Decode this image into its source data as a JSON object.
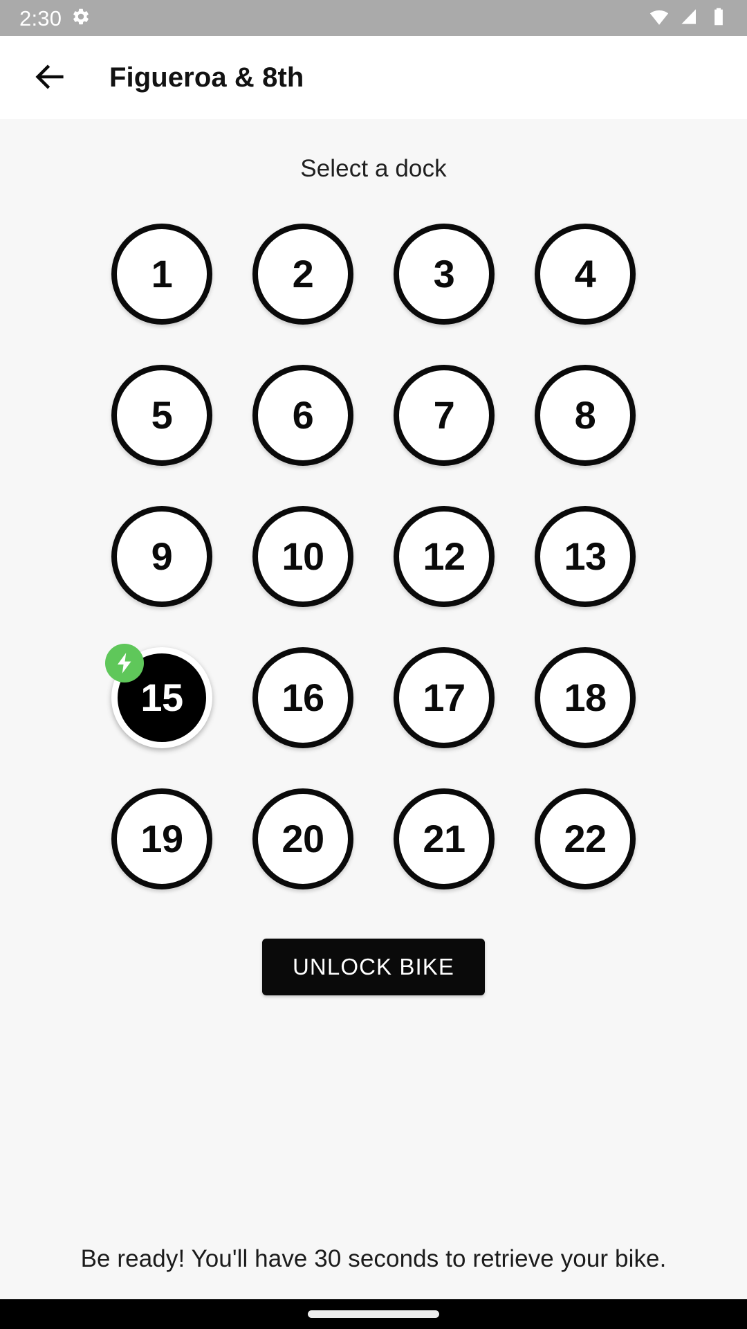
{
  "status_bar": {
    "clock": "2:30",
    "icons_left": [
      "gear-icon"
    ],
    "icons_right": [
      "wifi-icon",
      "cellular-signal-icon",
      "battery-icon"
    ],
    "background_color": "#AAAAAA",
    "foreground_color": "#FFFFFF"
  },
  "app_bar": {
    "back_label": "back-arrow",
    "title": "Figueroa & 8th"
  },
  "main": {
    "heading": "Select a dock",
    "docks": [
      {
        "number": "1",
        "selected": false,
        "charging": false
      },
      {
        "number": "2",
        "selected": false,
        "charging": false
      },
      {
        "number": "3",
        "selected": false,
        "charging": false
      },
      {
        "number": "4",
        "selected": false,
        "charging": false
      },
      {
        "number": "5",
        "selected": false,
        "charging": false
      },
      {
        "number": "6",
        "selected": false,
        "charging": false
      },
      {
        "number": "7",
        "selected": false,
        "charging": false
      },
      {
        "number": "8",
        "selected": false,
        "charging": false
      },
      {
        "number": "9",
        "selected": false,
        "charging": false
      },
      {
        "number": "10",
        "selected": false,
        "charging": false
      },
      {
        "number": "12",
        "selected": false,
        "charging": false
      },
      {
        "number": "13",
        "selected": false,
        "charging": false
      },
      {
        "number": "15",
        "selected": true,
        "charging": true
      },
      {
        "number": "16",
        "selected": false,
        "charging": false
      },
      {
        "number": "17",
        "selected": false,
        "charging": false
      },
      {
        "number": "18",
        "selected": false,
        "charging": false
      },
      {
        "number": "19",
        "selected": false,
        "charging": false
      },
      {
        "number": "20",
        "selected": false,
        "charging": false
      },
      {
        "number": "21",
        "selected": false,
        "charging": false
      },
      {
        "number": "22",
        "selected": false,
        "charging": false
      }
    ],
    "unlock_label": "UNLOCK BIKE",
    "footer_note": "Be ready! You'll have 30 seconds to retrieve your bike."
  },
  "colors": {
    "background": "#F7F7F7",
    "app_bar_background": "#FFFFFF",
    "dock_outline": "#0A0A0A",
    "dock_selected_fill": "#000000",
    "charge_badge_green": "#5FC75A",
    "button_background": "#0A0A0A",
    "button_text": "#FFFFFF",
    "nav_bar": "#000000"
  },
  "nav_bar": {
    "gesture_pill": "home-gesture-pill"
  }
}
